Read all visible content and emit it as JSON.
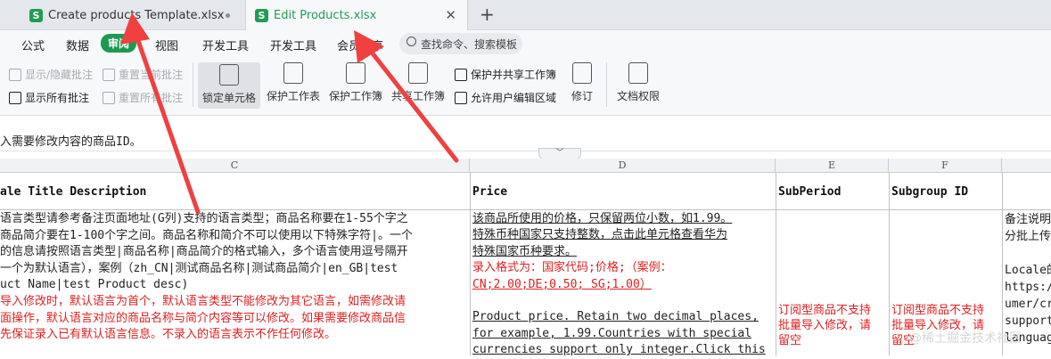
{
  "tabs": [
    {
      "icon": "S",
      "title": "Create products Template.xlsx"
    },
    {
      "icon": "S",
      "title": "Edit Products.xlsx"
    }
  ],
  "new_tab": "+",
  "menu": [
    "公式",
    "数据",
    "审阅",
    "视图",
    "开发工具",
    "开发工具",
    "会员专享"
  ],
  "search_placeholder": "查找命令、搜索模板",
  "ribbon": {
    "show_hide_comments": "显示/隐藏批注",
    "reset_current_comment": "重置当前批注",
    "show_all_comments": "显示所有批注",
    "reset_all_comments": "重置所有批注",
    "lock_cell": "锁定单元格",
    "protect_sheet": "保护工作表",
    "protect_book": "保护工作簿",
    "share_book": "共享工作簿",
    "protect_and_share": "保护并共享工作簿",
    "allow_edit_range": "允许用户编辑区域",
    "track_changes": "修订",
    "doc_permission": "文档权限"
  },
  "formula_text": "入需要修改内容的商品ID。",
  "columns": [
    "C",
    "D",
    "E",
    "F"
  ],
  "headers": {
    "c": "ale Title Description",
    "d": "Price",
    "e": "SubPeriod",
    "f": "Subgroup ID"
  },
  "cell_c": [
    {
      "t": "语言类型请参考备注页面地址(G列)支持的语言类型；商品名称要在1-55个字之",
      "red": false
    },
    {
      "t": "商品简介要在1-100个字之间。商品名称和简介不可以使用以下特殊字符|。一个",
      "red": false
    },
    {
      "t": "的信息请按照语言类型|商品名称|商品简介的格式输入，多个语言使用逗号隔开",
      "red": false
    },
    {
      "t": "一个为默认语言），案例（zh_CN|测试商品名称|测试商品简介|en_GB|test",
      "red": false
    },
    {
      "t": "uct Name|test Product desc)",
      "red": false
    },
    {
      "t": "导入修改时，默认语言为首个，默认语言类型不能修改为其它语言，如需修改请",
      "red": true
    },
    {
      "t": "面操作，默认语言对应的商品名称与简介内容等可以修改。如果需要修改商品信",
      "red": true
    },
    {
      "t": "先保证录入已有默认语言信息。不录入的语言表示不作任何修改。",
      "red": true
    }
  ],
  "cell_d": [
    {
      "t": "该商品所使用的价格，只保留两位小数，如1.99。",
      "red": false,
      "u": true
    },
    {
      "t": "特殊币种国家只支持整数，点击此单元格查看华为",
      "red": false,
      "u": true
    },
    {
      "t": "特殊国家币种要求。",
      "red": false,
      "u": true
    },
    {
      "t": "录入格式为：国家代码;价格;（案例：",
      "red": true,
      "u": false
    },
    {
      "t": "CN;2.00;DE;0.50; SG;1.00）",
      "red": true,
      "u": true
    },
    {
      "t": "",
      "red": false,
      "u": false
    },
    {
      "t": "Product price. Retain two decimal places,",
      "red": false,
      "u": true
    },
    {
      "t": "for example, 1.99.Countries with special",
      "red": false,
      "u": true
    },
    {
      "t": "currencies support only integer.Click this",
      "red": false,
      "u": true
    }
  ],
  "cell_e": [
    "订阅型商品不支持",
    "批量导入修改，请",
    "留空"
  ],
  "cell_f": [
    "订阅型商品不支持",
    "批量导入修改，请",
    "留空"
  ],
  "cell_g": [
    "备注说明",
    "分批上传",
    "",
    "Locale的",
    "https:/",
    "umer/cr",
    "support",
    "languag"
  ],
  "watermark": "@稀土掘金技术社区"
}
